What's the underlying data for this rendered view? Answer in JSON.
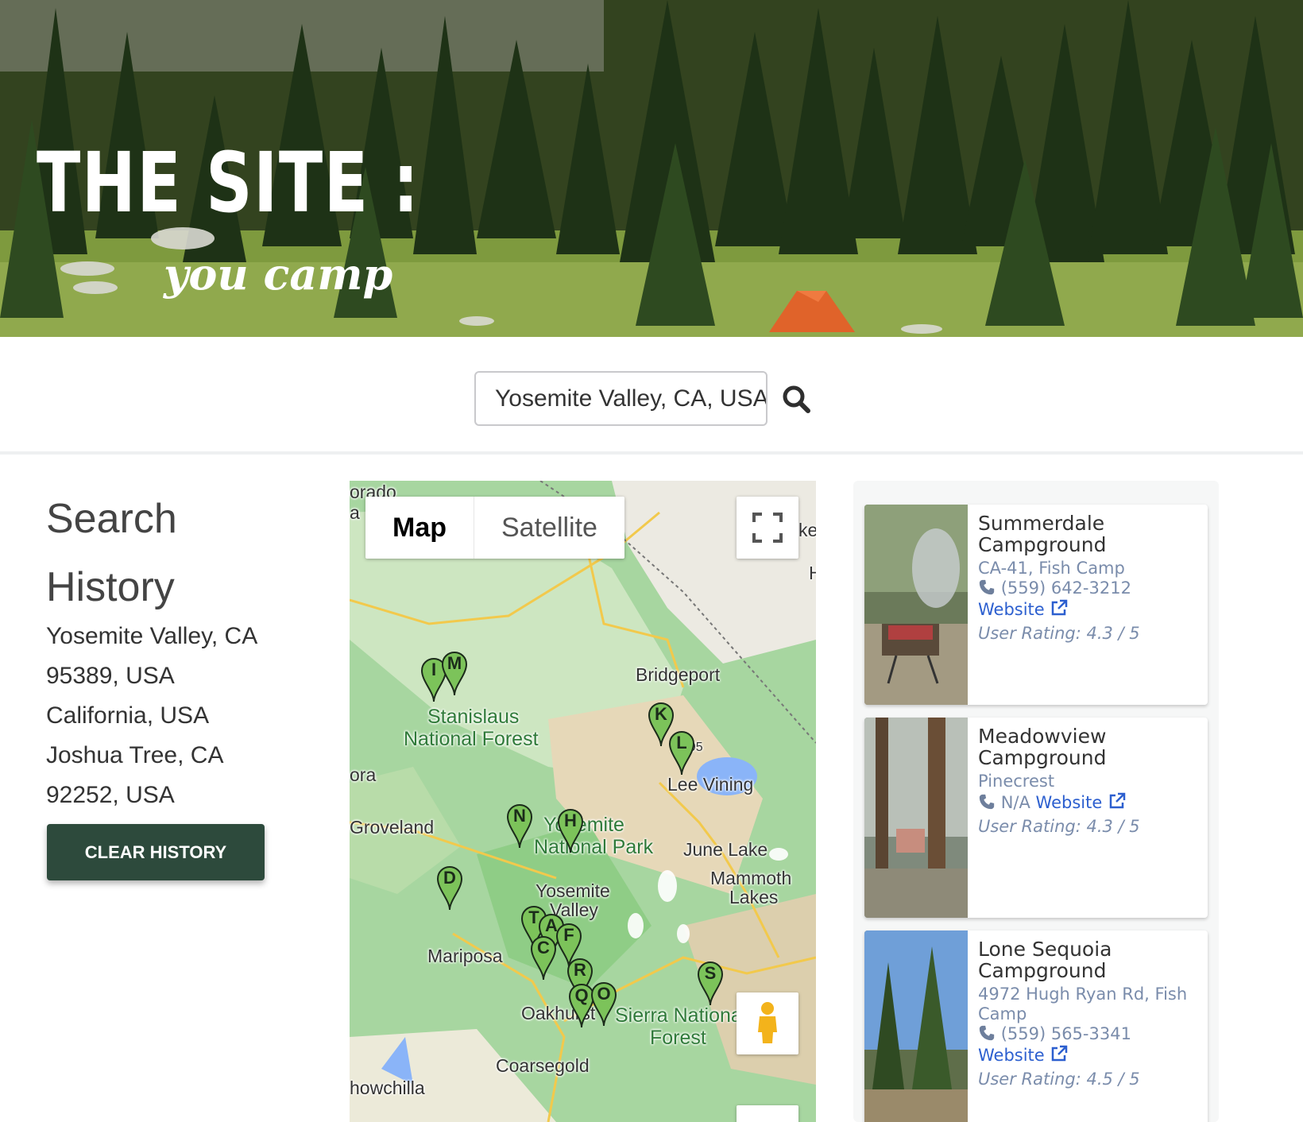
{
  "hero": {
    "title": "THE SITE :",
    "subtitle": "you camp"
  },
  "search": {
    "value": "Yosemite Valley, CA, USA"
  },
  "history": {
    "title": "Search History",
    "items": [
      "Yosemite Valley, CA",
      "95389, USA",
      "California, USA",
      "Joshua Tree, CA",
      "92252, USA"
    ],
    "clear_label": "CLEAR HISTORY"
  },
  "map": {
    "tab_map": "Map",
    "tab_satellite": "Satellite",
    "labels": [
      "orado",
      "a",
      "ke",
      "H",
      "Bridgeport",
      "Stanislaus",
      "National Forest",
      "ora",
      "395",
      "Lee Vining",
      "Groveland",
      "Yosemite",
      "National Park",
      "June Lake",
      "Mammoth",
      "Lakes",
      "Yosemite",
      "Valley",
      "Mariposa",
      "Oakhurst",
      "Sierra National",
      "Forest",
      "Coarsegold",
      "howchilla"
    ],
    "markers": [
      "I",
      "M",
      "K",
      "L",
      "N",
      "H",
      "D",
      "T",
      "A",
      "F",
      "C",
      "R",
      "Q",
      "O",
      "S"
    ]
  },
  "results": [
    {
      "name": "Summerdale Campground",
      "address": "CA-41, Fish Camp",
      "phone": "(559) 642-3212",
      "website_label": "Website",
      "rating": "User Rating: 4.3 / 5"
    },
    {
      "name": "Meadowview Campground",
      "address": "Pinecrest",
      "phone": "N/A",
      "website_label": "Website",
      "rating": "User Rating: 4.3 / 5"
    },
    {
      "name": "Lone Sequoia Campground",
      "address": "4972 Hugh Ryan Rd, Fish Camp",
      "phone": "(559) 565-3341",
      "website_label": "Website",
      "rating": "User Rating: 4.5 / 5"
    }
  ],
  "colors": {
    "button_bg": "#2d4a3c",
    "link": "#2c5fcf",
    "muted_text": "#7a8cab",
    "marker_fill": "#7cc35a"
  },
  "icons": [
    "search-icon",
    "phone-icon",
    "external-link-icon",
    "fullscreen-icon",
    "pegman-icon",
    "map-marker-icon"
  ]
}
